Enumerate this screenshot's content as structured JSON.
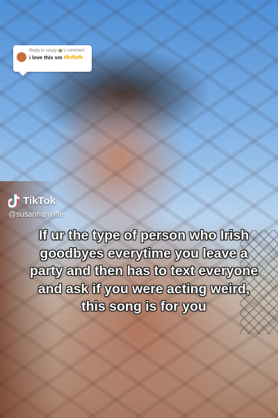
{
  "reply": {
    "header": "Reply to soupy 🍲's comment",
    "text": "i love this sm 🫶🫶🫶"
  },
  "tiktok": {
    "brand": "TikTok",
    "handle": "@susannahjoffe"
  },
  "caption": "If ur the type of person who Irish goodbyes everytime you leave a party and then has to text everyone and ask if you were acting weird, this song is for you"
}
